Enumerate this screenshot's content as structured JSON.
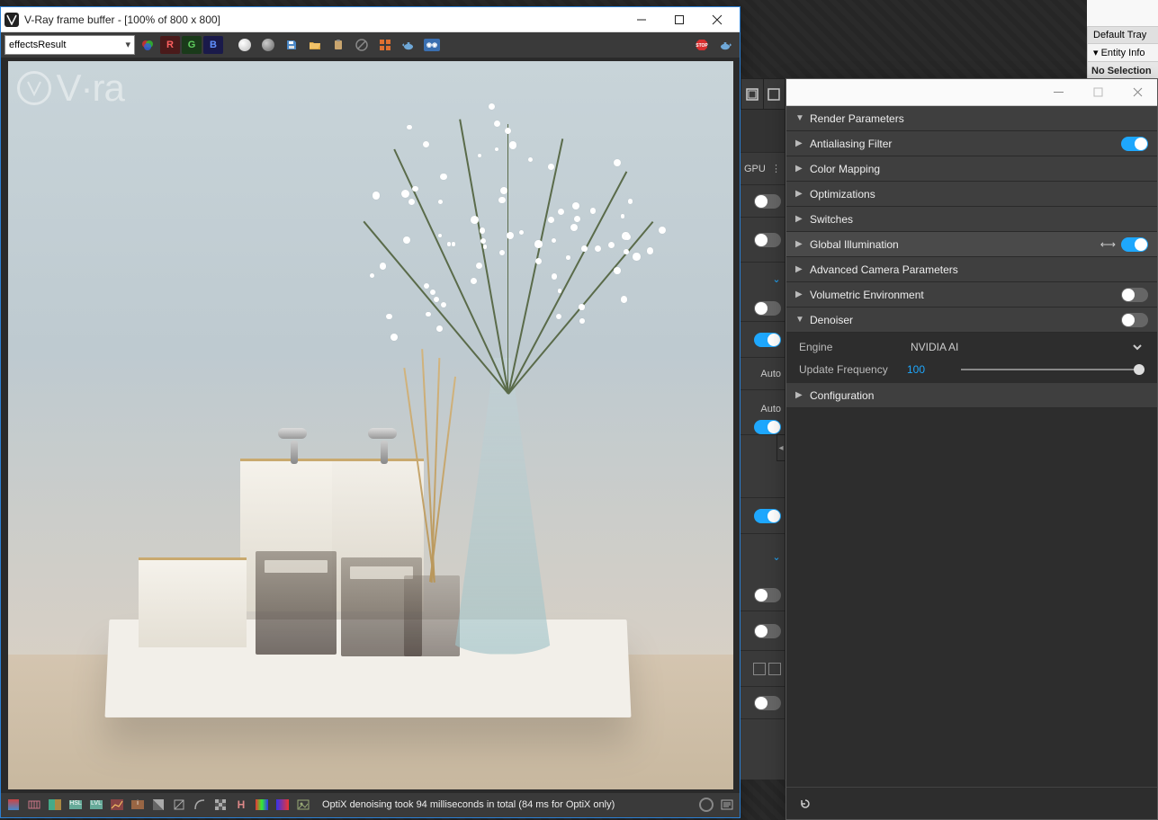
{
  "sketchup": {
    "tray_title": "Default Tray",
    "entity_info": "Entity Info",
    "no_selection": "No Selection"
  },
  "vfb": {
    "title": "V-Ray frame buffer - [100% of 800 x 800]",
    "channel": "effectsResult",
    "channels": {
      "r": "R",
      "g": "G",
      "b": "B"
    },
    "status": "OptiX denoising took 94 milliseconds in total (84 ms for OptiX only)",
    "watermark": "V·ra"
  },
  "midstrip": {
    "gpu_label": "GPU",
    "auto1": "Auto",
    "auto2": "Auto",
    "toggles": [
      true,
      false,
      true,
      false,
      true,
      true,
      false,
      false,
      false,
      false
    ]
  },
  "settings": {
    "sections": [
      {
        "label": "Render Parameters",
        "open": true
      },
      {
        "label": "Antialiasing Filter",
        "open": false,
        "toggle": true
      },
      {
        "label": "Color Mapping",
        "open": false
      },
      {
        "label": "Optimizations",
        "open": false
      },
      {
        "label": "Switches",
        "open": false
      },
      {
        "label": "Global Illumination",
        "open": false,
        "toggle": true,
        "slider_icon": true
      },
      {
        "label": "Advanced Camera Parameters",
        "open": false
      },
      {
        "label": "Volumetric Environment",
        "open": false,
        "toggle": false
      },
      {
        "label": "Denoiser",
        "open": true,
        "toggle": false
      }
    ],
    "denoiser": {
      "engine_label": "Engine",
      "engine_value": "NVIDIA AI",
      "freq_label": "Update Frequency",
      "freq_value": "100",
      "config": "Configuration"
    }
  }
}
